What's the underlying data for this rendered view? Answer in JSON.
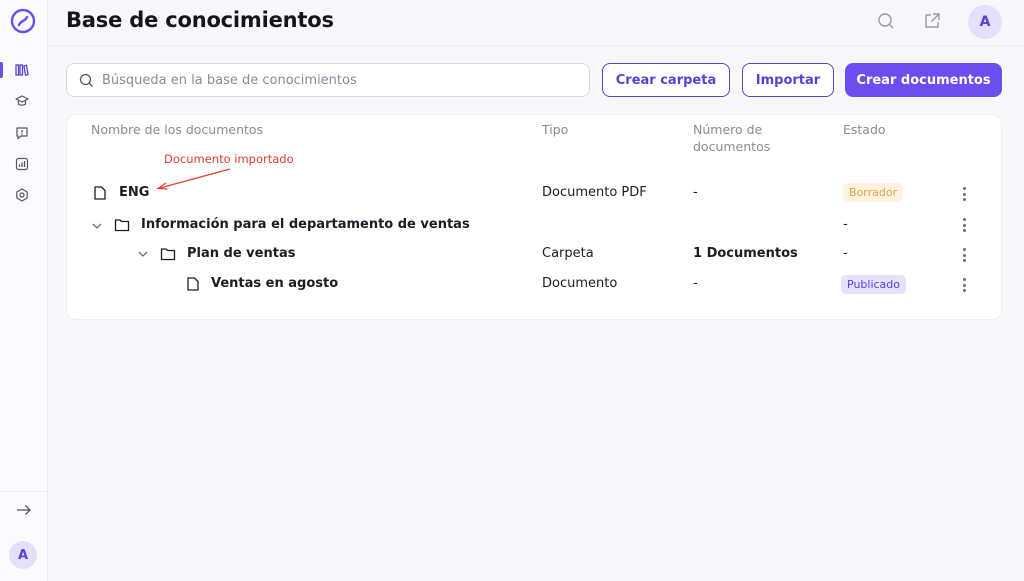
{
  "app": {
    "title": "Base de conocimientos",
    "accent": "#6b4ef0",
    "user_initial": "A"
  },
  "sidebar": {
    "items": [
      {
        "icon": "library-icon",
        "active": true
      },
      {
        "icon": "graduation-cap-icon",
        "active": false
      },
      {
        "icon": "alert-chat-icon",
        "active": false
      },
      {
        "icon": "analytics-icon",
        "active": false
      },
      {
        "icon": "settings-hexagon-icon",
        "active": false
      }
    ],
    "expand_icon": "arrow-right-icon",
    "avatar_initial": "A"
  },
  "header": {
    "icons": [
      "search-icon",
      "external-link-icon"
    ]
  },
  "toolbar": {
    "search_placeholder": "Búsqueda en la base de conocimientos",
    "create_folder_label": "Crear carpeta",
    "import_label": "Importar",
    "create_docs_label": "Crear documentos"
  },
  "table": {
    "columns": {
      "name": "Nombre de los documentos",
      "type": "Tipo",
      "count_line1": "Número de",
      "count_line2": "documentos",
      "status": "Estado"
    },
    "rows": [
      {
        "name": "ENG",
        "type": "Documento PDF",
        "count": "-",
        "status": "Borrador",
        "kind": "document",
        "level": 0
      },
      {
        "name": "Información para el departamento de ventas",
        "type": "",
        "count": "",
        "status": "-",
        "kind": "folder",
        "level": 0
      },
      {
        "name": "Plan de ventas",
        "type": "Carpeta",
        "count": "1 Documentos",
        "status": "-",
        "kind": "folder",
        "level": 1
      },
      {
        "name": "Ventas en agosto",
        "type": "Documento",
        "count": "-",
        "status": "Publicado",
        "kind": "document",
        "level": 2
      }
    ]
  },
  "annotation": {
    "text": "Documento importado",
    "color": "#e0402e"
  }
}
